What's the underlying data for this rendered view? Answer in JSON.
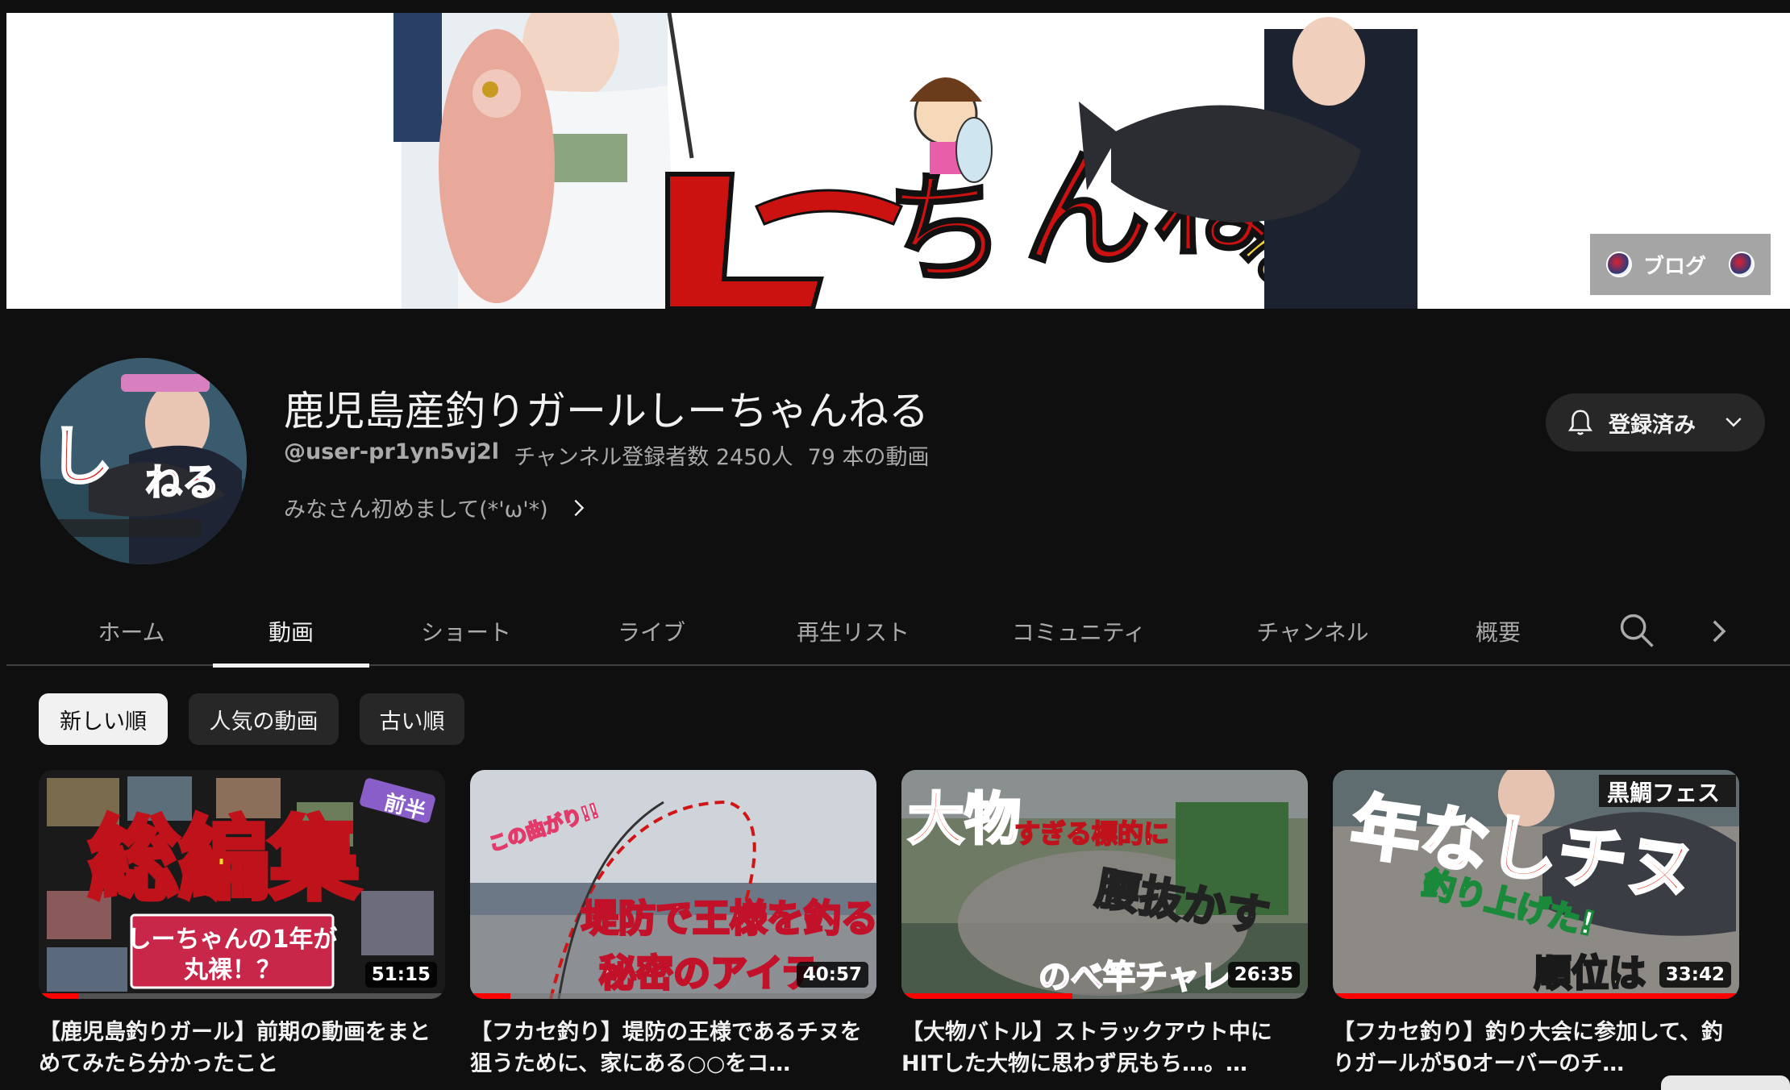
{
  "banner": {
    "link_label": "ブログ"
  },
  "channel": {
    "title": "鹿児島産釣りガールしーちゃんねる",
    "handle": "@user-pr1yn5vj2l",
    "subscribers": "チャンネル登録者数 2450人",
    "video_count": "79 本の動画",
    "description": "みなさん初めまして(*'ω'*)"
  },
  "subscribe_button": {
    "label": "登録済み",
    "icon": "bell-icon"
  },
  "tabs": [
    {
      "label": "ホーム"
    },
    {
      "label": "動画"
    },
    {
      "label": "ショート"
    },
    {
      "label": "ライブ"
    },
    {
      "label": "再生リスト"
    },
    {
      "label": "コミュニティ"
    },
    {
      "label": "チャンネル"
    },
    {
      "label": "概要"
    }
  ],
  "active_tab": "動画",
  "chips": [
    {
      "label": "新しい順"
    },
    {
      "label": "人気の動画"
    },
    {
      "label": "古い順"
    }
  ],
  "active_chip": "新しい順",
  "videos": [
    {
      "title": "【鹿児島釣りガール】前期の動画をまとめてみたら分かったこと",
      "duration": "51:15",
      "watched_fraction": 0.1,
      "thumb_text": [
        "総編集",
        "前半",
        "しーちゃんの1年が",
        "丸裸！？"
      ]
    },
    {
      "title": "【フカセ釣り】堤防の王様であるチヌを狙うために、家にある○○をコ…",
      "duration": "40:57",
      "watched_fraction": 0.1,
      "thumb_text": [
        "この曲がり!!",
        "堤防で王様を釣る",
        "秘密のアイテ"
      ]
    },
    {
      "title": "【大物バトル】ストラックアウト中にHITした大物に思わず尻もち…。…",
      "duration": "26:35",
      "watched_fraction": 0.42,
      "thumb_text": [
        "大物",
        "すぎる標的に",
        "腰抜かす",
        "のべ竿チャレ"
      ]
    },
    {
      "title": "【フカセ釣り】釣り大会に参加して、釣りガールが50オーバーのチ…",
      "duration": "33:42",
      "watched_fraction": 1.0,
      "thumb_text": [
        "黒鯛フェス",
        "年なしチヌ",
        "釣り上げた!",
        "順位は"
      ]
    }
  ],
  "colors": {
    "background": "#0f0f0f",
    "chip_bg": "#272727",
    "text_primary": "#f1f1f1",
    "text_secondary": "#aaaaaa",
    "progress": "#ff0000"
  }
}
